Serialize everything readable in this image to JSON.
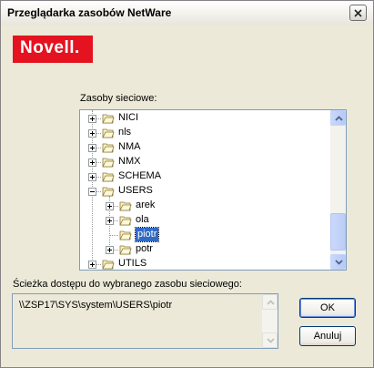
{
  "dialog": {
    "title": "Przeglądarka zasobów NetWare",
    "close_icon": "close-icon"
  },
  "logo": {
    "text": "Novell.",
    "color": "#e4131f"
  },
  "tree": {
    "label": "Zasoby sieciowe:",
    "items": [
      {
        "label": "NICI",
        "level": 0,
        "expander": "plus"
      },
      {
        "label": "nls",
        "level": 0,
        "expander": "plus"
      },
      {
        "label": "NMA",
        "level": 0,
        "expander": "plus"
      },
      {
        "label": "NMX",
        "level": 0,
        "expander": "plus"
      },
      {
        "label": "SCHEMA",
        "level": 0,
        "expander": "plus"
      },
      {
        "label": "USERS",
        "level": 0,
        "expander": "minus"
      },
      {
        "label": "arek",
        "level": 1,
        "expander": "plus"
      },
      {
        "label": "ola",
        "level": 1,
        "expander": "plus"
      },
      {
        "label": "piotr",
        "level": 1,
        "expander": "none",
        "selected": true
      },
      {
        "label": "potr",
        "level": 1,
        "expander": "plus"
      },
      {
        "label": "UTILS",
        "level": 0,
        "expander": "plus"
      }
    ],
    "selection_color": "#316ac5"
  },
  "path": {
    "label": "Ścieżka dostępu do wybranego zasobu sieciowego:",
    "value": "\\\\ZSP17\\SYS\\system\\USERS\\piotr"
  },
  "buttons": {
    "ok": "OK",
    "cancel": "Anuluj"
  }
}
